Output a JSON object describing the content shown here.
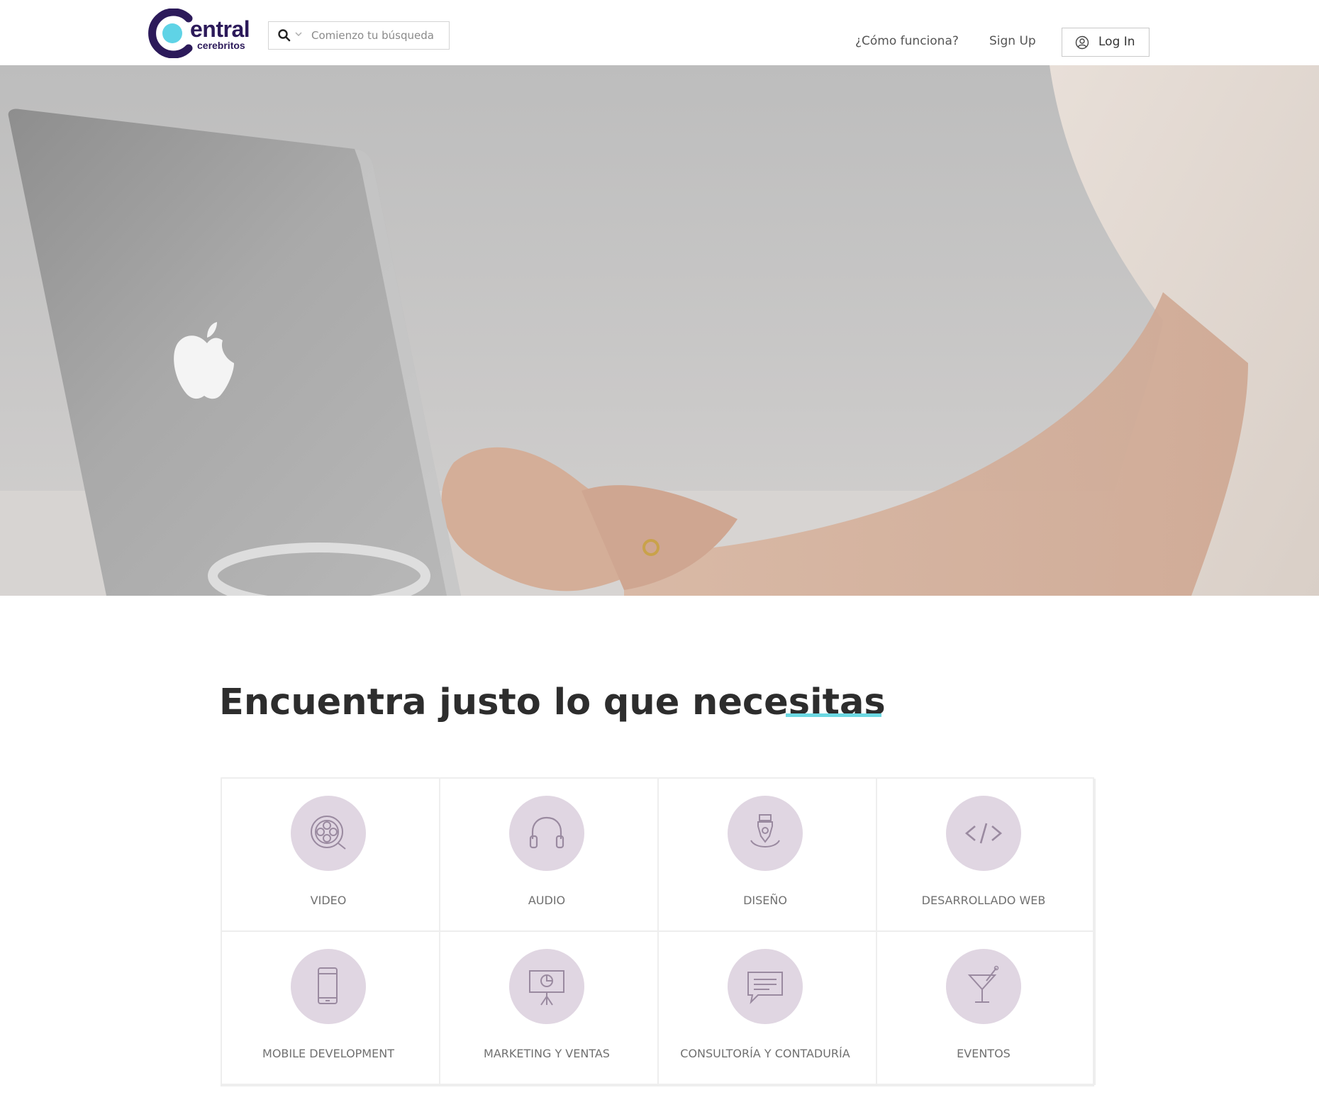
{
  "header": {
    "logo_main": "entral",
    "logo_sub": "cerebritos",
    "search_placeholder": "Comienzo tu búsqueda",
    "nav": {
      "how_it_works": "¿Cómo funciona?",
      "sign_up": "Sign Up",
      "log_in": "Log In"
    }
  },
  "hero": {
    "image": "woman-typing-on-laptop-photo"
  },
  "categories": {
    "title": "Encuentra justo lo que necesitas",
    "items": [
      {
        "label": "VIDEO",
        "icon": "film-reel-icon"
      },
      {
        "label": "AUDIO",
        "icon": "headphones-icon"
      },
      {
        "label": "DISEÑO",
        "icon": "pen-nib-icon"
      },
      {
        "label": "DESARROLLADO WEB",
        "icon": "code-icon"
      },
      {
        "label": "MOBILE DEVELOPMENT",
        "icon": "mobile-phone-icon"
      },
      {
        "label": "MARKETING Y VENTAS",
        "icon": "presentation-chart-icon"
      },
      {
        "label": "CONSULTORÍA Y CONTADURÍA",
        "icon": "chat-bubble-icon"
      },
      {
        "label": "EVENTOS",
        "icon": "cocktail-glass-icon"
      }
    ]
  },
  "colors": {
    "brand_dark": "#2c1a5a",
    "brand_cyan": "#5fd3e6",
    "accent_underline": "#6cd8e2",
    "icon_circle": "#e0d6e2",
    "icon_stroke": "#9a8aa0"
  }
}
